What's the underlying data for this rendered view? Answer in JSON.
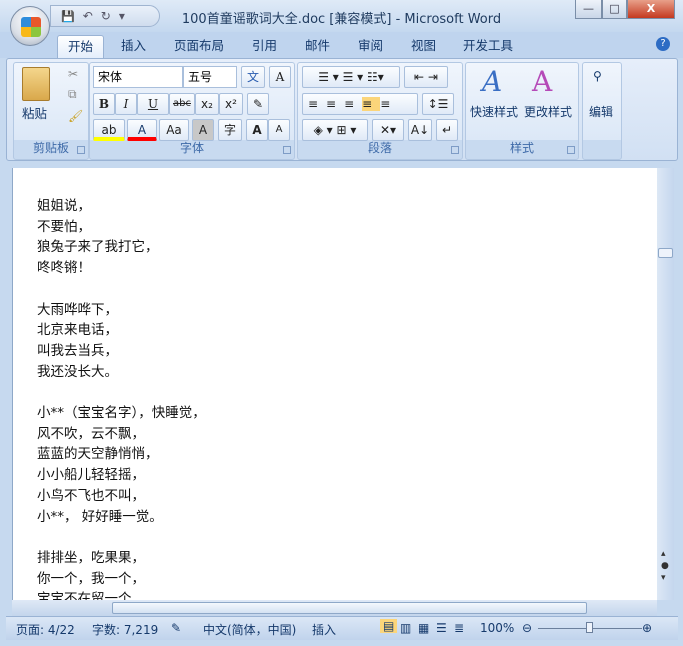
{
  "window": {
    "title": "100首童谣歌词大全.doc [兼容模式] - Microsoft Word",
    "minimize": "—",
    "restore": "□",
    "close": "X"
  },
  "qat": {
    "save": "💾",
    "undo": "↶",
    "redo": "↻",
    "customize": "▾"
  },
  "tabs": [
    "开始",
    "插入",
    "页面布局",
    "引用",
    "邮件",
    "审阅",
    "视图",
    "开发工具"
  ],
  "ribbon": {
    "clipboard": {
      "label": "剪贴板",
      "paste": "粘贴"
    },
    "font": {
      "label": "字体",
      "font_name": "宋体",
      "font_size": "五号",
      "bold": "B",
      "italic": "I",
      "underline": "U",
      "strike": "abc",
      "subscript": "x₂",
      "superscript": "x²",
      "grow": "A",
      "shrink": "A",
      "case": "Aa",
      "shade": "A",
      "enclose": "字",
      "phonetic": "文",
      "border_char": "A",
      "highlight_color": "#ffff00",
      "font_color": "#ff0000"
    },
    "paragraph": {
      "label": "段落"
    },
    "styles": {
      "label": "样式",
      "quick_styles": "快速样式",
      "change_styles": "更改样式"
    },
    "editing": {
      "label": "编辑"
    }
  },
  "document": {
    "lines": [
      "姐姐说，",
      "不要怕，",
      "狼兔子来了我打它，",
      "咚咚锵！",
      "",
      "大雨哗哗下，",
      "北京来电话，",
      "叫我去当兵，",
      "我还没长大。",
      "",
      "小**（宝宝名字），快睡觉，",
      "风不吹，云不飘，",
      "蓝蓝的天空静悄悄，",
      "小小船儿轻轻摇，",
      "小鸟不飞也不叫，",
      "小**， 好好睡一觉。",
      "",
      "排排坐，吃果果，",
      "你一个，我一个，",
      "宝宝不在留一个"
    ]
  },
  "status": {
    "page": "页面: 4/22",
    "words": "字数: 7,219",
    "language": "中文(简体，中国)",
    "mode": "插入",
    "zoom": "100%",
    "zoom_percent": 100
  }
}
